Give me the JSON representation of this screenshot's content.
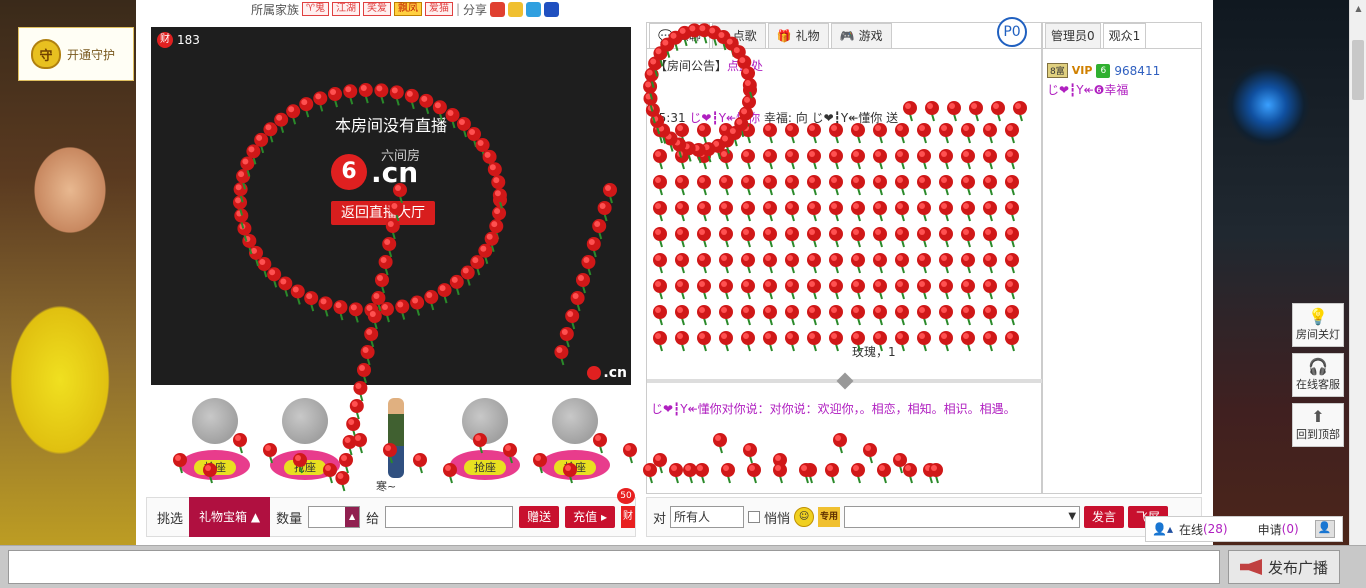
{
  "guard": {
    "label": "开通守护",
    "icon_char": "守"
  },
  "top_info": {
    "family_label": "所属家族",
    "tags": [
      "♈鬼",
      "江湖",
      "笑爱",
      "飘凤",
      "爱猫"
    ],
    "share_label": "分享"
  },
  "video": {
    "badge_char": "财",
    "viewer_count": "183",
    "no_live_text": "本房间没有直播",
    "logo_circle": "6",
    "logo_text": ".cn",
    "logo_sub": "六间房",
    "return_label": "返回直播大厅",
    "corner_logo": ".cn"
  },
  "seats": {
    "label": "抢座",
    "name_below": "寒~"
  },
  "gift_bar": {
    "pick_label": "挑选",
    "box_label": "礼物宝箱",
    "qty_label": "数量",
    "to_label": "给",
    "give_label": "赠送",
    "recharge_label": "充值",
    "cai_char": "财",
    "cai_badge": "50"
  },
  "chat_tabs": [
    {
      "label": "公聊"
    },
    {
      "label": "点歌"
    },
    {
      "label": "礼物"
    },
    {
      "label": "游戏"
    }
  ],
  "p_badge": "P0",
  "chat": {
    "notice_prefix": "【房间公告】",
    "notice_link": "点此处",
    "time": "05:31",
    "line_user": "じ❤┇Y↞懂你",
    "line_text": "幸福: 向 じ❤┇Y↞懂你 送",
    "gift_msg": "玫瑰，1",
    "private_text": "じ❤┇Y↞懂你对你说：对你说：欢迎你，。相恋，相知。相识。相遇。"
  },
  "user_tabs": [
    {
      "label": "管理员0"
    },
    {
      "label": "观众1"
    }
  ],
  "users": {
    "rank": "8富",
    "vip": "VIP",
    "lvl": "6",
    "id": "968411",
    "name": "じ❤┇Y↞❻幸福"
  },
  "send_bar": {
    "to_label": "对",
    "target": "所有人",
    "whisper_label": "悄悄",
    "special_label": "专用",
    "send_label": "发言",
    "fly_label": "飞屏"
  },
  "online": {
    "online_label": "在线",
    "online_count": "(28)",
    "apply_label": "申请",
    "apply_count": "(0)"
  },
  "side": {
    "light_label": "房间关灯",
    "service_label": "在线客服",
    "top_label": "回到顶部"
  },
  "broadcast": {
    "label": "发布广播"
  },
  "colors": {
    "accent": "#b01040",
    "red": "#c8102e",
    "purple": "#b020c0"
  }
}
